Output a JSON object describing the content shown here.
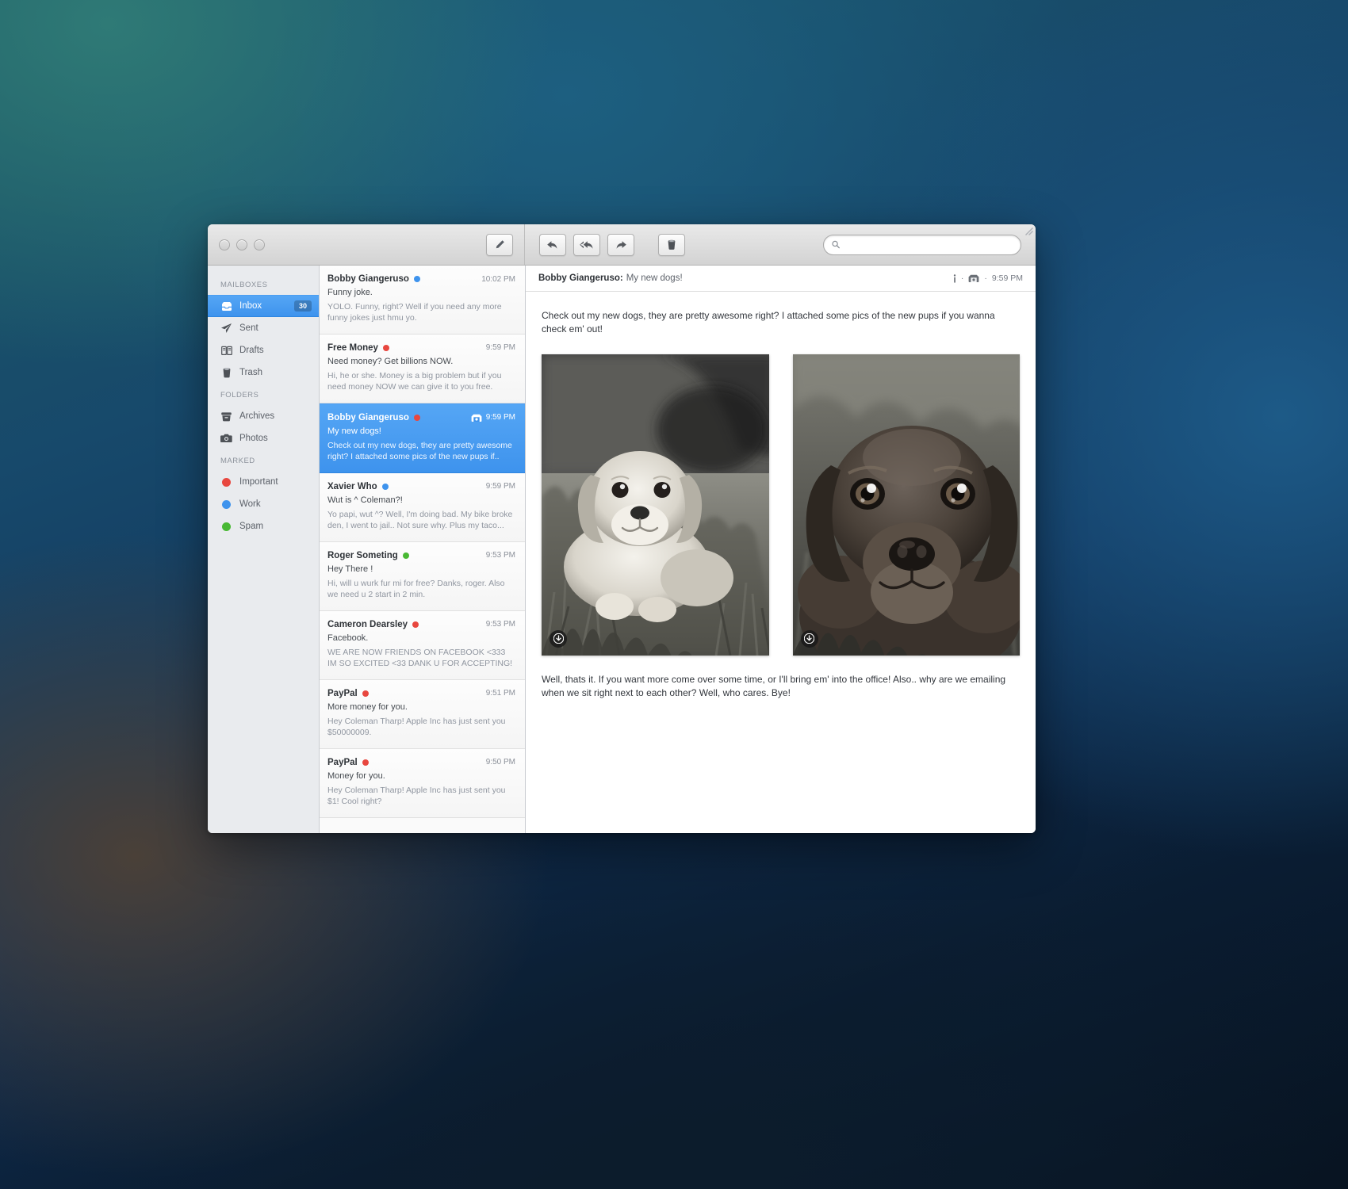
{
  "window": {
    "traffic_lights": [
      "close",
      "minimize",
      "zoom"
    ],
    "compose_label": "compose",
    "toolbar": {
      "reply": "Reply",
      "reply_all": "Reply All",
      "forward": "Forward",
      "delete": "Delete"
    },
    "search": {
      "value": "",
      "placeholder": ""
    }
  },
  "sidebar": {
    "sections": [
      {
        "title": "MAILBOXES",
        "items": [
          {
            "label": "Inbox",
            "icon": "inbox-icon",
            "badge": "30",
            "active": true
          },
          {
            "label": "Sent",
            "icon": "paper-plane-icon",
            "badge": "",
            "active": false
          },
          {
            "label": "Drafts",
            "icon": "book-icon",
            "badge": "",
            "active": false
          },
          {
            "label": "Trash",
            "icon": "trash-icon",
            "badge": "",
            "active": false
          }
        ]
      },
      {
        "title": "FOLDERS",
        "items": [
          {
            "label": "Archives",
            "icon": "archive-box-icon",
            "badge": "",
            "active": false
          },
          {
            "label": "Photos",
            "icon": "camera-icon",
            "badge": "",
            "active": false
          }
        ]
      },
      {
        "title": "MARKED",
        "items": [
          {
            "label": "Important",
            "icon": "dot-icon",
            "color": "#e8473f",
            "badge": "",
            "active": false
          },
          {
            "label": "Work",
            "icon": "dot-icon",
            "color": "#3e93ed",
            "badge": "",
            "active": false
          },
          {
            "label": "Spam",
            "icon": "dot-icon",
            "color": "#49b934",
            "badge": "",
            "active": false
          }
        ]
      }
    ]
  },
  "messages": [
    {
      "from": "Bobby Giangeruso",
      "flag_color": "#3e93ed",
      "time": "10:02 PM",
      "subject": "Funny joke.",
      "preview": "YOLO. Funny, right? Well if you need any more funny jokes just hmu yo.",
      "selected": false,
      "has_attachment": false
    },
    {
      "from": "Free Money",
      "flag_color": "#e8473f",
      "time": "9:59 PM",
      "subject": "Need money? Get billions NOW.",
      "preview": "Hi, he or she. Money is a big problem but if you need money NOW we can give it to you free.",
      "selected": false,
      "has_attachment": false
    },
    {
      "from": "Bobby Giangeruso",
      "flag_color": "#e8473f",
      "time": "9:59 PM",
      "subject": "My new dogs!",
      "preview": "Check out my new dogs, they are pretty awesome right? I attached some pics of the new pups if..",
      "selected": true,
      "has_attachment": true
    },
    {
      "from": "Xavier Who",
      "flag_color": "#3e93ed",
      "time": "9:59 PM",
      "subject": "Wut is ^ Coleman?!",
      "preview": "Yo papi, wut ^? Well, I'm doing bad. My bike broke den, I went to jail.. Not sure why.  Plus my taco...",
      "selected": false,
      "has_attachment": false
    },
    {
      "from": "Roger Someting",
      "flag_color": "#49b934",
      "time": "9:53 PM",
      "subject": "Hey There !",
      "preview": "Hi, will u wurk fur mi for free? Danks, roger. Also we need u 2 start in 2 min.",
      "selected": false,
      "has_attachment": false
    },
    {
      "from": "Cameron Dearsley",
      "flag_color": "#e8473f",
      "time": "9:53 PM",
      "subject": "Facebook.",
      "preview": "WE ARE NOW FRIENDS ON FACEBOOK <333 IM SO EXCITED <33 DANK U FOR ACCEPTING!",
      "selected": false,
      "has_attachment": false
    },
    {
      "from": "PayPal",
      "flag_color": "#e8473f",
      "time": "9:51 PM",
      "subject": "More money for you.",
      "preview": "Hey Coleman Tharp! Apple Inc has just sent you $50000009.",
      "selected": false,
      "has_attachment": false
    },
    {
      "from": "PayPal",
      "flag_color": "#e8473f",
      "time": "9:50 PM",
      "subject": "Money for you.",
      "preview": "Hey Coleman Tharp! Apple Inc has just sent you $1! Cool right?",
      "selected": false,
      "has_attachment": false
    }
  ],
  "reader": {
    "from": "Bobby Giangeruso:",
    "subject": "My new dogs!",
    "meta_time": "9:59 PM",
    "meta_separator": "·",
    "body_top": "Check out my new dogs, they are pretty awesome right? I attached some pics of the new pups if you wanna check em' out!",
    "body_bottom": "Well, thats it. If you want more come over some time, or I'll bring em' into the office! Also.. why are we emailing when we sit right next to each other? Well, who cares. Bye!",
    "attachments": [
      {
        "alt": "yellow-labrador-puppy-photo",
        "download_label": "download"
      },
      {
        "alt": "chocolate-labrador-puppy-photo",
        "download_label": "download"
      }
    ]
  }
}
